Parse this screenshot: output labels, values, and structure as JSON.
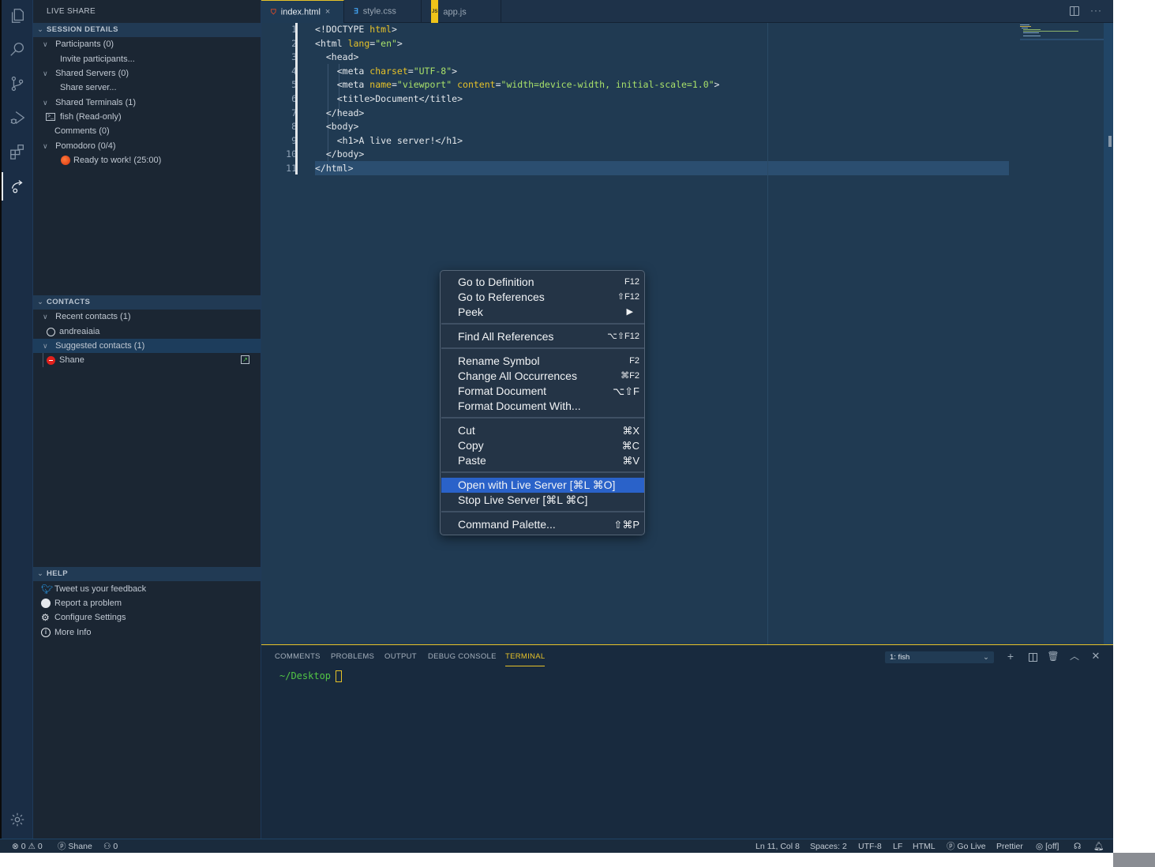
{
  "sidebar": {
    "title": "LIVE SHARE",
    "sections": {
      "session": {
        "label": "SESSION DETAILS",
        "items": [
          {
            "label": "Participants (0)",
            "type": "group"
          },
          {
            "label": "Invite participants...",
            "type": "action"
          },
          {
            "label": "Shared Servers (0)",
            "type": "group"
          },
          {
            "label": "Share server...",
            "type": "action"
          },
          {
            "label": "Shared Terminals (1)",
            "type": "group"
          },
          {
            "label": "fish (Read-only)",
            "type": "terminal"
          },
          {
            "label": "Comments (0)",
            "type": "leaf"
          },
          {
            "label": "Pomodoro (0/4)",
            "type": "group"
          },
          {
            "label": "Ready to work! (25:00)",
            "type": "timer"
          }
        ]
      },
      "contacts": {
        "label": "CONTACTS",
        "items": [
          {
            "label": "Recent contacts (1)",
            "type": "group"
          },
          {
            "label": "andreaiaia",
            "type": "contact",
            "status": "offline"
          },
          {
            "label": "Suggested contacts (1)",
            "type": "group"
          },
          {
            "label": "Shane",
            "type": "contact",
            "status": "busy"
          }
        ]
      },
      "help": {
        "label": "HELP",
        "items": [
          {
            "label": "Tweet us your feedback",
            "icon": "twitter-icon"
          },
          {
            "label": "Report a problem",
            "icon": "github-icon"
          },
          {
            "label": "Configure Settings",
            "icon": "gear-icon"
          },
          {
            "label": "More Info",
            "icon": "info-icon"
          }
        ]
      }
    }
  },
  "tabs": [
    {
      "label": "index.html",
      "icon": "html5-icon",
      "active": true
    },
    {
      "label": "style.css",
      "icon": "css3-icon",
      "active": false
    },
    {
      "label": "app.js",
      "icon": "js-icon",
      "active": false
    }
  ],
  "editor": {
    "line_numbers": [
      "1",
      "2",
      "3",
      "4",
      "5",
      "6",
      "7",
      "8",
      "9",
      "10",
      "11"
    ],
    "lines": [
      "<!DOCTYPE html>",
      "<html lang=\"en\">",
      "  <head>",
      "    <meta charset=\"UTF-8\">",
      "    <meta name=\"viewport\" content=\"width=device-width, initial-scale=1.0\">",
      "    <title>Document</title>",
      "  </head>",
      "  <body>",
      "    <h1>A live server!</h1>",
      "  </body>",
      "</html>"
    ]
  },
  "context_menu": {
    "groups": [
      [
        {
          "label": "Go to Definition",
          "shortcut": "F12"
        },
        {
          "label": "Go to References",
          "shortcut": "⇧F12"
        },
        {
          "label": "Peek",
          "shortcut": "▶"
        }
      ],
      [
        {
          "label": "Find All References",
          "shortcut": "⌥⇧F12"
        }
      ],
      [
        {
          "label": "Rename Symbol",
          "shortcut": "F2"
        },
        {
          "label": "Change All Occurrences",
          "shortcut": "⌘F2"
        },
        {
          "label": "Format Document",
          "shortcut": "⌥⇧F"
        },
        {
          "label": "Format Document With...",
          "shortcut": ""
        }
      ],
      [
        {
          "label": "Cut",
          "shortcut": "⌘X"
        },
        {
          "label": "Copy",
          "shortcut": "⌘C"
        },
        {
          "label": "Paste",
          "shortcut": "⌘V"
        }
      ],
      [
        {
          "label": "Open with Live Server [⌘L ⌘O]",
          "shortcut": "",
          "highlighted": true
        },
        {
          "label": "Stop Live Server [⌘L ⌘C]",
          "shortcut": ""
        }
      ],
      [
        {
          "label": "Command Palette...",
          "shortcut": "⇧⌘P"
        }
      ]
    ]
  },
  "panel": {
    "tabs": [
      "COMMENTS",
      "PROBLEMS",
      "OUTPUT",
      "DEBUG CONSOLE",
      "TERMINAL"
    ],
    "active_tab": "TERMINAL",
    "terminal_select": "1: fish",
    "prompt": "~/Desktop"
  },
  "statusbar": {
    "errors": "0",
    "warnings": "0",
    "live_share_user": "Shane",
    "participants": "0",
    "cursor": "Ln 11, Col 8",
    "spaces": "Spaces: 2",
    "encoding": "UTF-8",
    "eol": "LF",
    "language": "HTML",
    "go_live": "Go Live",
    "formatter": "Prettier",
    "watch": "[off]"
  },
  "colors": {
    "accent": "#e6c229",
    "menu_highlight": "#2a62c9",
    "terminal_prompt": "#52c545",
    "busy_status": "#e0201c"
  }
}
